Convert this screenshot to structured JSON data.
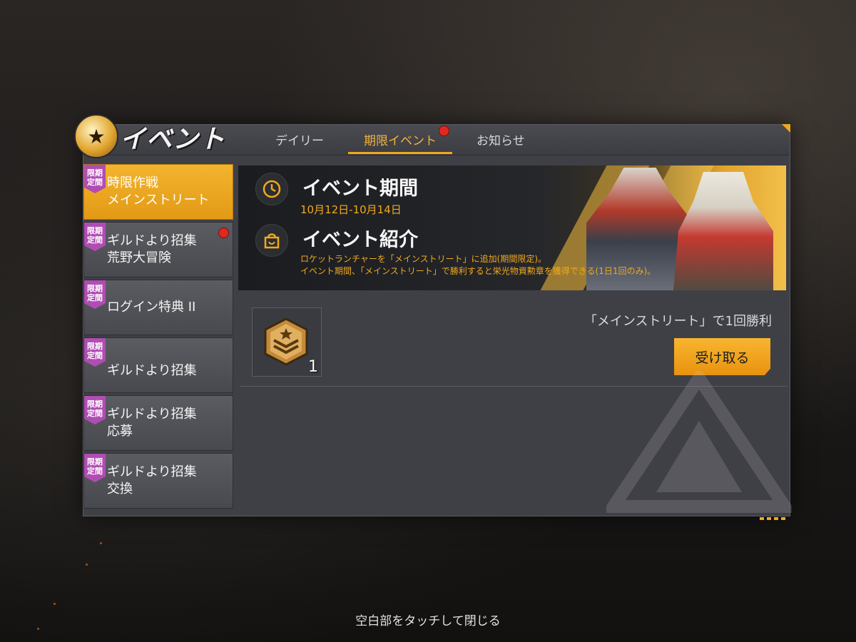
{
  "header": {
    "title": "イベント",
    "tabs": [
      {
        "label": "デイリー",
        "active": false
      },
      {
        "label": "期限イベント",
        "active": true,
        "badge": "red-dot"
      },
      {
        "label": "お知らせ",
        "active": false
      }
    ]
  },
  "sidebar": {
    "items": [
      {
        "tag": "限期定間",
        "tag_line1": "限期",
        "tag_line2": "定間",
        "line1": "時限作戦",
        "line2": "メインストリート",
        "active": true
      },
      {
        "tag_line1": "限期",
        "tag_line2": "定間",
        "line1": "ギルドより招集",
        "line2": "荒野大冒険",
        "badge": "red-dot"
      },
      {
        "tag_line1": "限期",
        "tag_line2": "定間",
        "line1": "ログイン特典 II",
        "line2": ""
      },
      {
        "tag_line1": "限期",
        "tag_line2": "定間",
        "line1": "ギルドより招集",
        "line2": ""
      },
      {
        "tag_line1": "限期",
        "tag_line2": "定間",
        "line1": "ギルドより招集",
        "line2": "応募"
      },
      {
        "tag_line1": "限期",
        "tag_line2": "定間",
        "line1": "ギルドより招集",
        "line2": "交換"
      }
    ]
  },
  "banner": {
    "period_heading": "イベント期間",
    "period_value": "10月12日-10月14日",
    "intro_heading": "イベント紹介",
    "intro_line1": "ロケットランチャーを「メインストリート」に追加(期間限定)。",
    "intro_line2": "イベント期間、「メインストリート」で勝利すると栄光物資勲章を獲得できる(1日1回のみ)。"
  },
  "reward": {
    "icon": "medal-icon",
    "count": "1",
    "condition": "「メインストリート」で1回勝利",
    "claim_label": "受け取る"
  },
  "footer": {
    "hint": "空白部をタッチして閉じる"
  },
  "colors": {
    "accent": "#f0a91e",
    "panel": "#3f4046",
    "tag": "#b04db3",
    "badge": "#e0281f"
  }
}
